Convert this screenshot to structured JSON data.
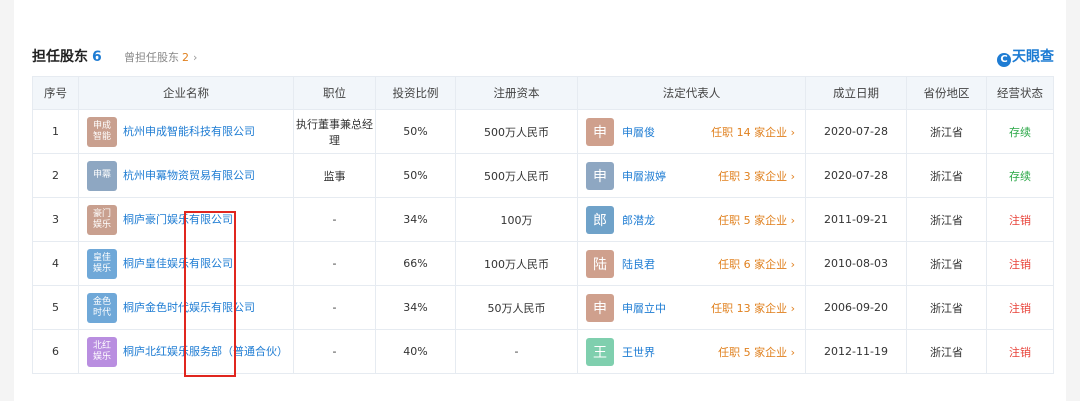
{
  "header": {
    "title": "担任股东",
    "count": "6",
    "former_label": "曾担任股东",
    "former_count": "2",
    "former_arrow": "›",
    "brand": "天眼查",
    "brand_logo": "C"
  },
  "columns": [
    "序号",
    "企业名称",
    "职位",
    "投资比例",
    "注册资本",
    "法定代表人",
    "成立日期",
    "省份地区",
    "经营状态"
  ],
  "rows": [
    {
      "no": "1",
      "logo": "申成智能",
      "logo_color": "#c9a08f",
      "name": "杭州申成智能科技有限公司",
      "position": "执行董事兼总经理",
      "ratio": "50%",
      "capital": "500万人民币",
      "rep_char": "申",
      "rep_color": "#cfa08d",
      "rep": "申層俊",
      "rep_other": "任职 14 家企业 ›",
      "date": "2020-07-28",
      "region": "浙江省",
      "status": "存续",
      "status_type": "live"
    },
    {
      "no": "2",
      "logo": "申冪",
      "logo_color": "#8ea7c2",
      "name": "杭州申冪物资贸易有限公司",
      "position": "监事",
      "ratio": "50%",
      "capital": "500万人民币",
      "rep_char": "申",
      "rep_color": "#8ea7c2",
      "rep": "申層淑婷",
      "rep_other": "任职 3 家企业 ›",
      "date": "2020-07-28",
      "region": "浙江省",
      "status": "存续",
      "status_type": "live"
    },
    {
      "no": "3",
      "logo": "豪门娱乐",
      "logo_color": "#c9a08f",
      "name": "桐庐豪门娱乐有限公司",
      "position": "-",
      "ratio": "34%",
      "capital": "100万",
      "rep_char": "郎",
      "rep_color": "#6fa2c9",
      "rep": "郎潜龙",
      "rep_other": "任职 5 家企业 ›",
      "date": "2011-09-21",
      "region": "浙江省",
      "status": "注销",
      "status_type": "cancel"
    },
    {
      "no": "4",
      "logo": "皇佳娱乐",
      "logo_color": "#6fa8d8",
      "name": "桐庐皇佳娱乐有限公司",
      "position": "-",
      "ratio": "66%",
      "capital": "100万人民币",
      "rep_char": "陆",
      "rep_color": "#cfa08d",
      "rep": "陆良君",
      "rep_other": "任职 6 家企业 ›",
      "date": "2010-08-03",
      "region": "浙江省",
      "status": "注销",
      "status_type": "cancel"
    },
    {
      "no": "5",
      "logo": "金色时代",
      "logo_color": "#6fa8d8",
      "name": "桐庐金色时代娱乐有限公司",
      "position": "-",
      "ratio": "34%",
      "capital": "50万人民币",
      "rep_char": "申",
      "rep_color": "#cfa08d",
      "rep": "申層立中",
      "rep_other": "任职 13 家企业 ›",
      "date": "2006-09-20",
      "region": "浙江省",
      "status": "注销",
      "status_type": "cancel"
    },
    {
      "no": "6",
      "logo": "北红娱乐",
      "logo_color": "#b98ee0",
      "name": "桐庐北红娱乐服务部（普通合伙）",
      "position": "-",
      "ratio": "40%",
      "capital": "-",
      "rep_char": "王",
      "rep_color": "#7fcfae",
      "rep": "王世界",
      "rep_other": "任职 5 家企业 ›",
      "date": "2012-11-19",
      "region": "浙江省",
      "status": "注销",
      "status_type": "cancel"
    }
  ]
}
